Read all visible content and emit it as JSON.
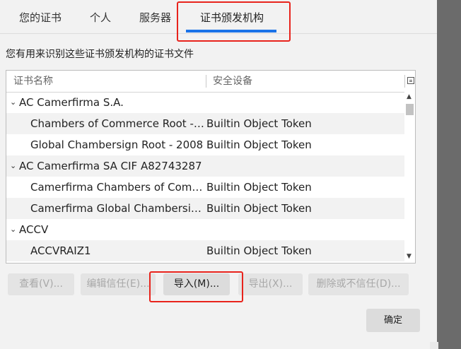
{
  "tabs": [
    {
      "label": "您的证书"
    },
    {
      "label": "个人"
    },
    {
      "label": "服务器"
    },
    {
      "label": "证书颁发机构"
    }
  ],
  "description": "您有用来识别这些证书颁发机构的证书文件",
  "columns": {
    "name": "证书名称",
    "device": "安全设备"
  },
  "rows": [
    {
      "name": "AC Camerfirma S.A.",
      "token": ""
    },
    {
      "name": "Chambers of Commerce Root - ...",
      "token": "Builtin Object Token"
    },
    {
      "name": "Global Chambersign Root - 2008",
      "token": "Builtin Object Token"
    },
    {
      "name": "AC Camerfirma SA CIF A82743287",
      "token": ""
    },
    {
      "name": "Camerfirma Chambers of Comm...",
      "token": "Builtin Object Token"
    },
    {
      "name": "Camerfirma Global Chambersig...",
      "token": "Builtin Object Token"
    },
    {
      "name": "ACCV",
      "token": ""
    },
    {
      "name": "ACCVRAIZ1",
      "token": "Builtin Object Token"
    }
  ],
  "buttons": {
    "view": "查看(V)...",
    "edit_trust": "编辑信任(E)...",
    "import": "导入(M)...",
    "export": "导出(X)...",
    "delete": "删除或不信任(D)..."
  },
  "ok": "确定",
  "colors": {
    "selected_tab_underline": "#1a73e8",
    "annotation": "#e8231c"
  }
}
